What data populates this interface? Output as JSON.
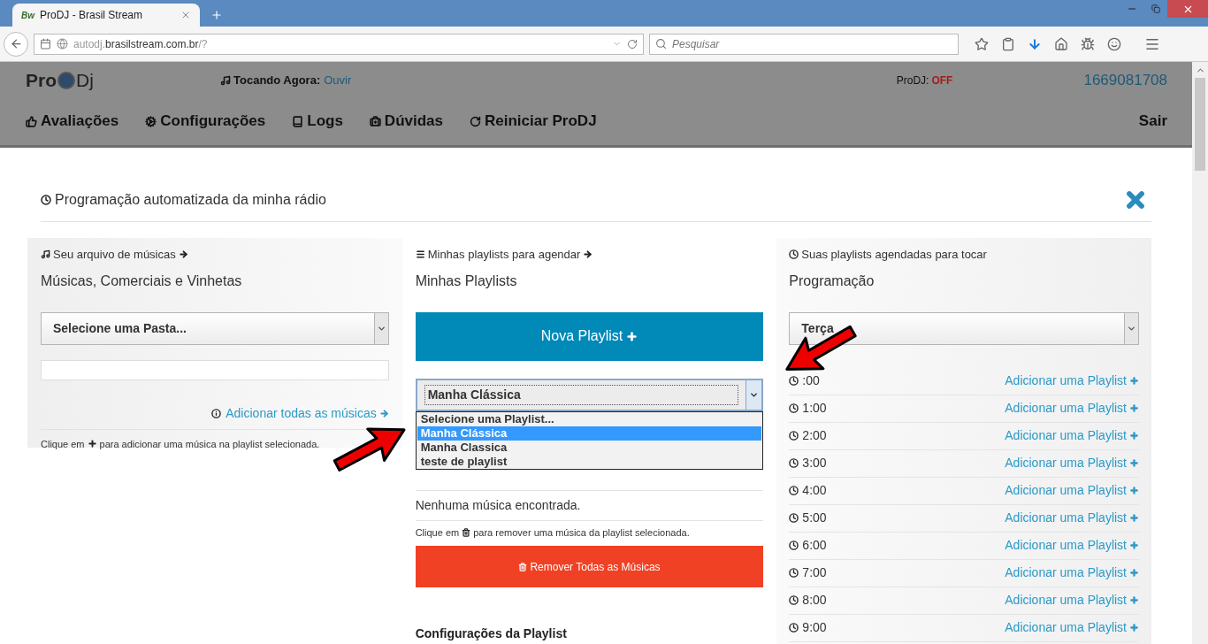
{
  "browser": {
    "favicon_text": "Bw",
    "tab_title": "ProDJ - Brasil Stream",
    "url": {
      "prefix": "autodj.",
      "domain": "brasilstream.com.br",
      "suffix": "/?"
    },
    "search_placeholder": "Pesquisar"
  },
  "header": {
    "logo": {
      "left": "Pro",
      "right": "Dj"
    },
    "now_playing": {
      "label": "Tocando Agora:",
      "link": "Ouvir"
    },
    "status": {
      "label": "ProDJ:",
      "value": "OFF",
      "on": false
    },
    "account": "1669081708",
    "nav": [
      {
        "label": "Avaliações",
        "kind": "thumb"
      },
      {
        "label": "Configurações",
        "kind": "gear"
      },
      {
        "label": "Logs",
        "kind": "book"
      },
      {
        "label": "Dúvidas",
        "kind": "kit"
      },
      {
        "label": "Reiniciar ProDJ",
        "kind": "refresh"
      }
    ],
    "logout": "Sair"
  },
  "modal": {
    "title": "Programação automatizada da minha rádio",
    "library": {
      "caption": "Seu arquivo de músicas",
      "heading": "Músicas, Comerciais e Vinhetas",
      "folder_select": "Selecione uma Pasta...",
      "add_all": "Adicionar todas as músicas",
      "hint_before": "Clique em",
      "hint_after": "para adicionar uma música na playlist selecionada."
    },
    "playlists": {
      "caption": "Minhas playlists para agendar",
      "heading": "Minhas Playlists",
      "new_button": "Nova Playlist",
      "select_value": "Manha Clássica",
      "expanded": true,
      "options": [
        {
          "label": "Selecione uma Playlist...",
          "selected": false
        },
        {
          "label": "Manha Clássica",
          "selected": true
        },
        {
          "label": "Manha Classica",
          "selected": false
        },
        {
          "label": "teste de playlist",
          "selected": false
        }
      ],
      "empty": "Nenhuma música encontrada.",
      "hint_before": "Clique em",
      "hint_after": "para remover uma música da playlist selecionada.",
      "remove_all": "Remover Todas as Músicas",
      "settings_heading": "Configurações da Playlist"
    },
    "schedule": {
      "caption": "Suas playlists agendadas para tocar",
      "heading": "Programação",
      "day_select": "Terça",
      "rows": [
        {
          "time": ":00",
          "link": "Adicionar uma Playlist"
        },
        {
          "time": "1:00",
          "link": "Adicionar uma Playlist"
        },
        {
          "time": "2:00",
          "link": "Adicionar uma Playlist"
        },
        {
          "time": "3:00",
          "link": "Adicionar uma Playlist"
        },
        {
          "time": "4:00",
          "link": "Adicionar uma Playlist"
        },
        {
          "time": "5:00",
          "link": "Adicionar uma Playlist"
        },
        {
          "time": "6:00",
          "link": "Adicionar uma Playlist"
        },
        {
          "time": "7:00",
          "link": "Adicionar uma Playlist"
        },
        {
          "time": "8:00",
          "link": "Adicionar uma Playlist"
        },
        {
          "time": "9:00",
          "link": "Adicionar uma Playlist"
        }
      ]
    }
  }
}
